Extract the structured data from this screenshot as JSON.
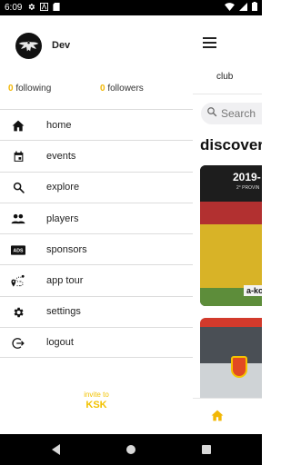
{
  "status_bar": {
    "time": "6:09",
    "left_icons": [
      "gear-icon",
      "notification-a-icon",
      "sd-card-icon"
    ],
    "right_icons": [
      "wifi-icon",
      "signal-icon",
      "battery-icon"
    ]
  },
  "drawer": {
    "user": {
      "name": "Dev"
    },
    "stats": {
      "following_count": "0",
      "following_label": "following",
      "followers_count": "0",
      "followers_label": "followers"
    },
    "items": [
      {
        "label": "home",
        "icon": "home-icon"
      },
      {
        "label": "events",
        "icon": "calendar-icon"
      },
      {
        "label": "explore",
        "icon": "search-icon"
      },
      {
        "label": "players",
        "icon": "people-icon"
      },
      {
        "label": "sponsors",
        "icon": "ads-icon"
      },
      {
        "label": "app tour",
        "icon": "route-icon"
      },
      {
        "label": "settings",
        "icon": "gear-icon"
      },
      {
        "label": "logout",
        "icon": "logout-icon"
      }
    ],
    "invite": {
      "line1": "invite to",
      "line2": "KSK"
    }
  },
  "background_app": {
    "tab_label": "club",
    "search_placeholder": "Search",
    "section_title": "discover",
    "card1": {
      "year_text": "2019-",
      "sub_text": "2° PROVIN",
      "logo_text": "a-ko"
    }
  },
  "colors": {
    "accent": "#f2b705",
    "invite": "#f2c200",
    "divider": "#dcdcdc",
    "status_bar": "#000000"
  }
}
